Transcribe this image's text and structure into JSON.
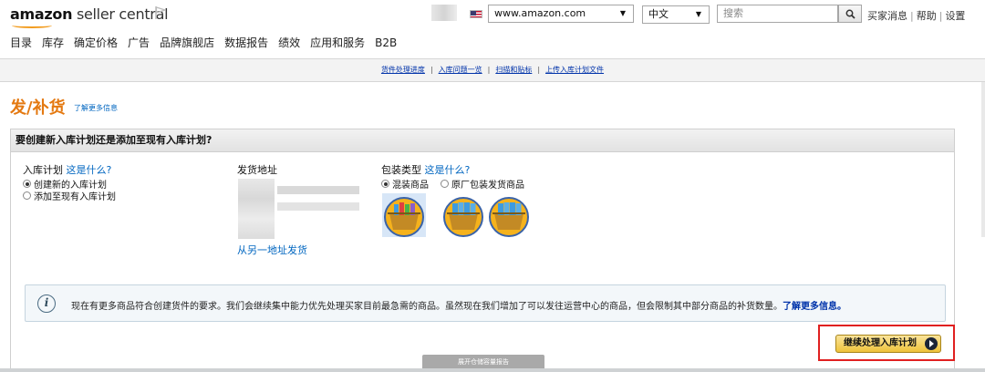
{
  "header": {
    "logo_bold": "amazon",
    "logo_rest": " seller central",
    "marketplace": "www.amazon.com",
    "language": "中文",
    "search_placeholder": "搜索",
    "links": [
      "买家消息",
      "帮助",
      "设置"
    ]
  },
  "nav": [
    "目录",
    "库存",
    "确定价格",
    "广告",
    "品牌旗舰店",
    "数据报告",
    "绩效",
    "应用和服务",
    "B2B"
  ],
  "subnav": [
    "货件处理进度",
    "入库问题一览",
    "扫描和贴标",
    "上传入库计划文件"
  ],
  "page": {
    "title": "发/补货",
    "learn_more": "了解更多信息"
  },
  "panel": {
    "heading": "要创建新入库计划还是添加至现有入库计划?",
    "plan_label": "入库计划",
    "plan_help": "这是什么?",
    "plan_options": [
      "创建新的入库计划",
      "添加至现有入库计划"
    ],
    "address_label": "发货地址",
    "ship_from_other": "从另一地址发货",
    "packing_label": "包装类型",
    "packing_help": "这是什么?",
    "packing_options": [
      "混装商品",
      "原厂包装发货商品"
    ]
  },
  "notice": {
    "text": "现在有更多商品符合创建货件的要求。我们会继续集中能力优先处理买家目前最急需的商品。虽然现在我们增加了可以发往运营中心的商品，但会限制其中部分商品的补货数量。",
    "link": "了解更多信息。"
  },
  "continue_label": "继续处理入库计划",
  "bottom_tab": "展开仓储容量报告"
}
